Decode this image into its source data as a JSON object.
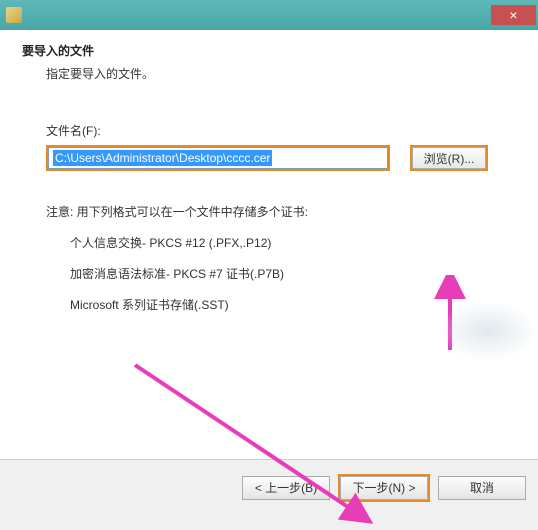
{
  "titlebar": {
    "close_label": "×"
  },
  "header": {
    "title": "要导入的文件",
    "subtitle": "指定要导入的文件。"
  },
  "file": {
    "label": "文件名(F):",
    "value": "C:\\Users\\Administrator\\Desktop\\cccc.cer",
    "browse_label": "浏览(R)..."
  },
  "note": "注意: 用下列格式可以在一个文件中存储多个证书:",
  "formats": [
    "个人信息交换- PKCS #12 (.PFX,.P12)",
    "加密消息语法标准- PKCS #7 证书(.P7B)",
    "Microsoft 系列证书存储(.SST)"
  ],
  "footer": {
    "back_label": "< 上一步(B)",
    "next_label": "下一步(N) >",
    "cancel_label": "取消"
  }
}
